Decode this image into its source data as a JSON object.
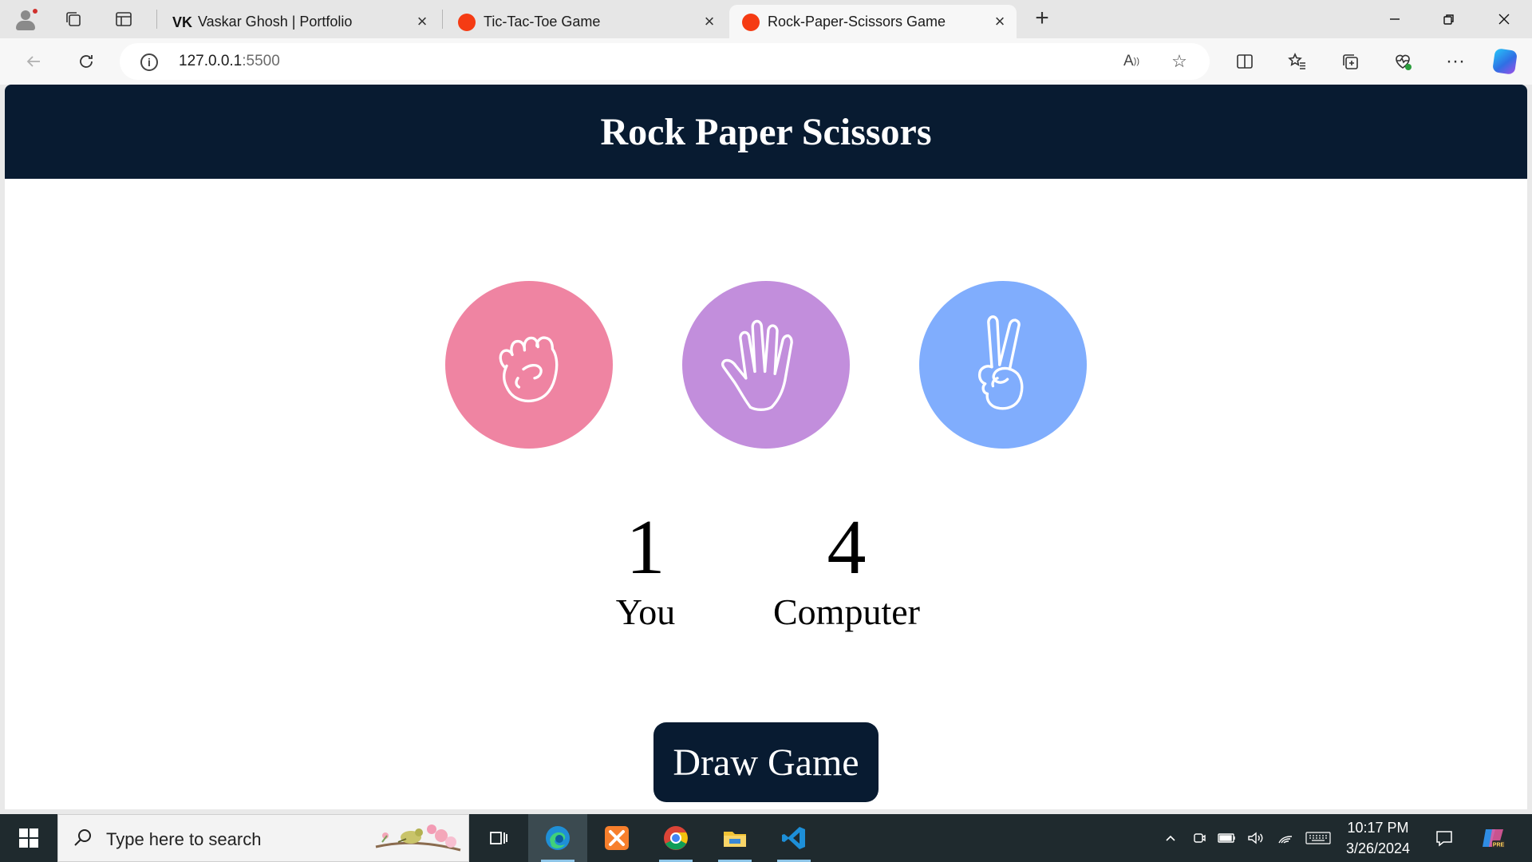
{
  "browser": {
    "tabs": [
      {
        "title": "Vaskar Ghosh | Portfolio",
        "favicon": "vk"
      },
      {
        "title": "Tic-Tac-Toe Game",
        "favicon": "red-dot"
      },
      {
        "title": "Rock-Paper-Scissors Game",
        "favicon": "red-dot",
        "active": true
      }
    ],
    "address": {
      "host": "127.0.0.1",
      "port": ":5500"
    }
  },
  "game": {
    "title": "Rock Paper Scissors",
    "choices": [
      {
        "id": "rock",
        "color": "#ef84a2"
      },
      {
        "id": "paper",
        "color": "#c28edc"
      },
      {
        "id": "scissors",
        "color": "#80adfd"
      }
    ],
    "scores": {
      "user": {
        "value": "1",
        "label": "You"
      },
      "computer": {
        "value": "4",
        "label": "Computer"
      }
    },
    "message": "Draw Game",
    "colors": {
      "header": "#081b31",
      "message_bg": "#081b31"
    }
  },
  "taskbar": {
    "search_placeholder": "Type here to search",
    "time": "10:17 PM",
    "date": "3/26/2024"
  }
}
